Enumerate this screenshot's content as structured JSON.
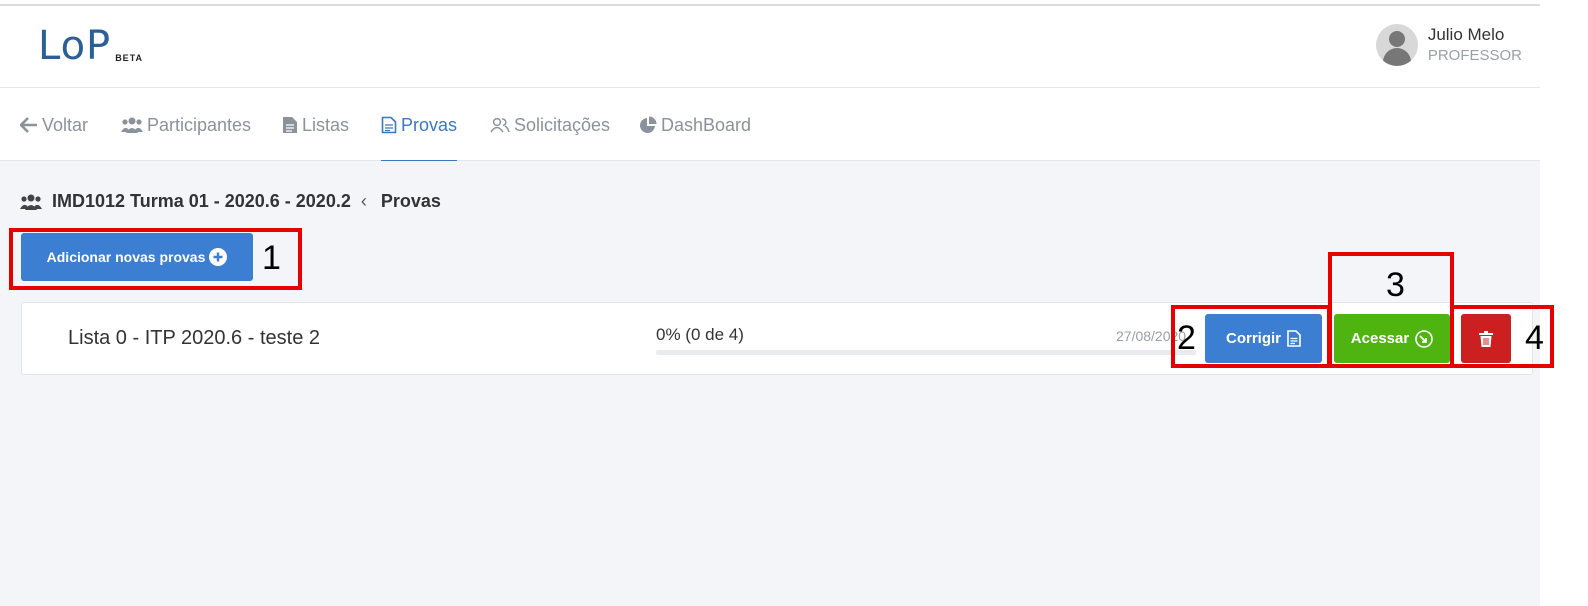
{
  "header": {
    "logo": "LoP",
    "logo_badge": "BETA",
    "user_name": "Julio Melo",
    "user_role": "PROFESSOR"
  },
  "nav": {
    "items": [
      {
        "label": "Voltar",
        "icon": "arrow-left-icon"
      },
      {
        "label": "Participantes",
        "icon": "users-icon"
      },
      {
        "label": "Listas",
        "icon": "file-icon"
      },
      {
        "label": "Provas",
        "icon": "file-text-icon",
        "active": true
      },
      {
        "label": "Solicitações",
        "icon": "user-group-outline-icon"
      },
      {
        "label": "DashBoard",
        "icon": "pie-chart-icon"
      }
    ]
  },
  "breadcrumb": {
    "class_name": "IMD1012 Turma 01 - 2020.6 - 2020.2",
    "current": "Provas"
  },
  "actions": {
    "add_label": "Adicionar novas provas"
  },
  "exams": [
    {
      "title": "Lista 0 - ITP 2020.6 - teste 2",
      "progress_text": "0% (0 de 4)",
      "progress_fraction": 0,
      "date": "27/08/2020",
      "correct_label": "Corrigir",
      "access_label": "Acessar"
    }
  ],
  "annotations": [
    "1",
    "2",
    "3",
    "4"
  ],
  "colors": {
    "primary": "#3c7fd2",
    "success": "#4fb40f",
    "danger": "#cc1f1f",
    "annotation": "#e80000"
  }
}
